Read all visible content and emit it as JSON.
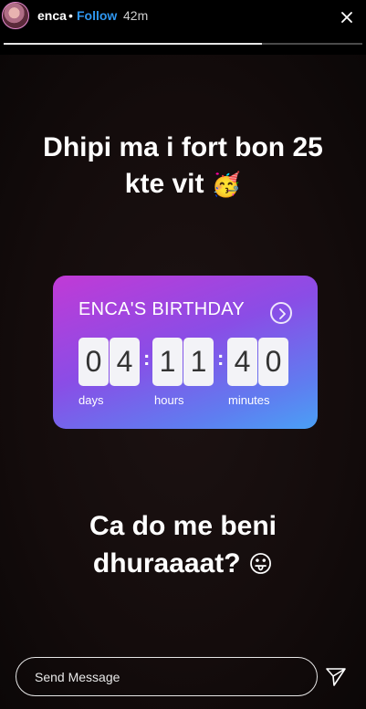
{
  "header": {
    "username": "enca",
    "separator": "•",
    "follow_label": "Follow",
    "time": "42m",
    "avatar_icon": "profile-avatar",
    "more_icon": "more-dots-icon",
    "story_progress": 0.72
  },
  "story": {
    "text_line_1": "Dhipi ma i fort bon 25",
    "text_line_2": "kte vit",
    "emoji_1": "🥳",
    "text_bottom_line_1": "Ca do me beni",
    "text_bottom_line_2": "dhuraaaat?",
    "emoji_2": "😛"
  },
  "countdown": {
    "title": "ENCA'S BIRTHDAY",
    "digits": [
      "0",
      "4",
      "1",
      "1",
      "4",
      "0"
    ],
    "colon": ":",
    "units": [
      "days",
      "hours",
      "minutes"
    ],
    "accent_colors": [
      "#c13ad6",
      "#4aa0f5"
    ]
  },
  "footer": {
    "message_placeholder": "Send Message",
    "send_icon": "paper-plane-icon"
  }
}
